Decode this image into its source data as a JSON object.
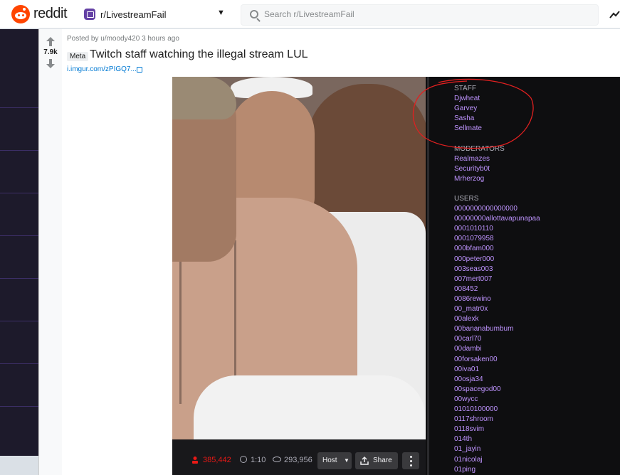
{
  "header": {
    "wordmark": "reddit",
    "subreddit": "r/LivestreamFail",
    "search_placeholder": "Search r/LivestreamFail"
  },
  "post": {
    "vote_count": "7.9k",
    "posted_by": "Posted by u/moody420 3 hours ago",
    "flair": "Meta",
    "title": "Twitch staff watching the illegal stream LUL",
    "link": "i.imgur.com/zPIGQ7..."
  },
  "player": {
    "viewers": "385,442",
    "uptime": "1:10",
    "views": "293,956",
    "host_label": "Host",
    "share_label": "Share"
  },
  "chatters": {
    "staff_header": "STAFF",
    "staff": [
      "Djwheat",
      "Garvey",
      "Sasha",
      "Sellmate"
    ],
    "moderators_header": "MODERATORS",
    "moderators": [
      "Realmazes",
      "Securityb0t",
      "Mrherzog"
    ],
    "users_header": "USERS",
    "users": [
      "0000000000000000",
      "00000000allottavapunapaa",
      "0001010110",
      "0001079958",
      "000bfam000",
      "000peter000",
      "003seas003",
      "007mert007",
      "008452",
      "0086rewino",
      "00_matr0x",
      "00alexk",
      "00bananabumbum",
      "00carl70",
      "00dambi",
      "00forsaken00",
      "00iva01",
      "00osja34",
      "00spacegod00",
      "00wycc",
      "01010100000",
      "0117shroom",
      "0118svim",
      "014th",
      "01_jayin",
      "01nicolaj",
      "01ping"
    ]
  },
  "colors": {
    "reddit_orange": "#ff4500",
    "twitch_purple": "#bf94ff",
    "annotation_red": "#e02020",
    "link_blue": "#0079d3"
  }
}
